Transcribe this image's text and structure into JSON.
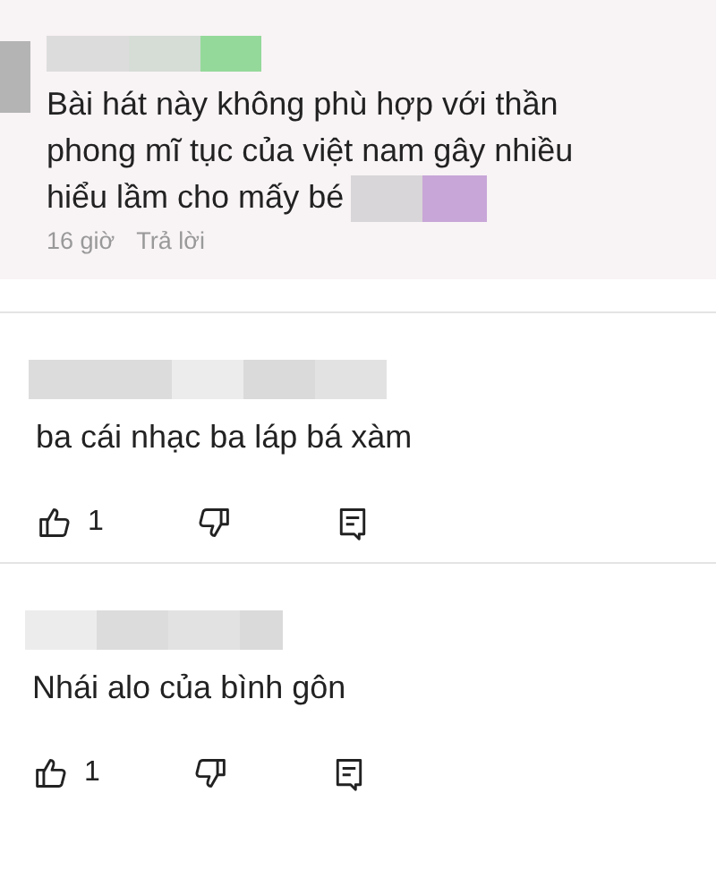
{
  "comments": [
    {
      "kind": "highlighted",
      "text": "Bài hát này không phù hợp với thần phong mĩ tục của việt nam gây nhiều hiểu lầm cho mấy bé",
      "time": "16 giờ",
      "reply_label": "Trả lời"
    },
    {
      "kind": "plain",
      "text": "ba cái nhạc ba láp bá xàm",
      "likes": "1"
    },
    {
      "kind": "plain",
      "text": "Nhái alo của bình gôn",
      "likes": "1"
    }
  ]
}
